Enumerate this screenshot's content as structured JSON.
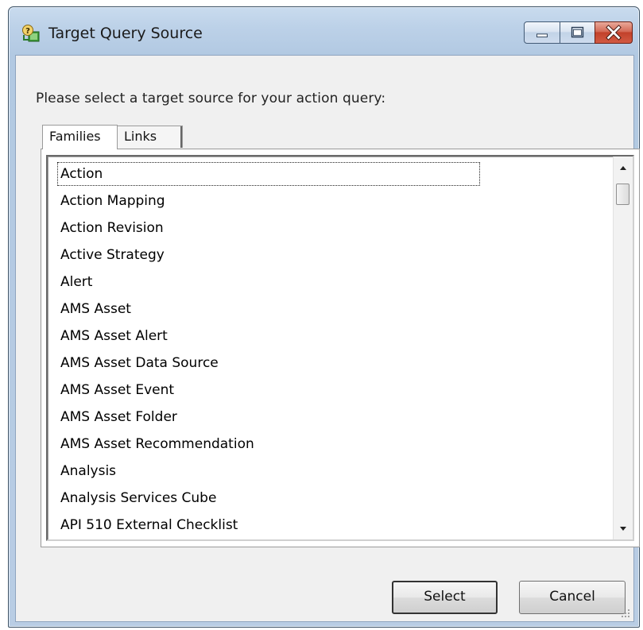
{
  "window": {
    "title": "Target Query Source",
    "icon": "query-source-icon",
    "controls": {
      "minimize": "minimize-icon",
      "maximize": "maximize-icon",
      "close": "close-icon"
    }
  },
  "prompt": "Please select a target source for your action query:",
  "tabs": [
    {
      "label": "Families",
      "active": true
    },
    {
      "label": "Links",
      "active": false
    }
  ],
  "list": {
    "items": [
      "Action",
      "Action Mapping",
      "Action Revision",
      "Active Strategy",
      "Alert",
      "AMS Asset",
      "AMS Asset Alert",
      "AMS Asset Data Source",
      "AMS Asset Event",
      "AMS Asset Folder",
      "AMS Asset Recommendation",
      "Analysis",
      "Analysis Services Cube",
      "API 510 External Checklist"
    ],
    "focused_index": 0
  },
  "buttons": {
    "select": "Select",
    "cancel": "Cancel"
  },
  "colors": {
    "frame": "#bcd1e8",
    "client": "#f0f0f0",
    "close_button": "#c2412a"
  }
}
